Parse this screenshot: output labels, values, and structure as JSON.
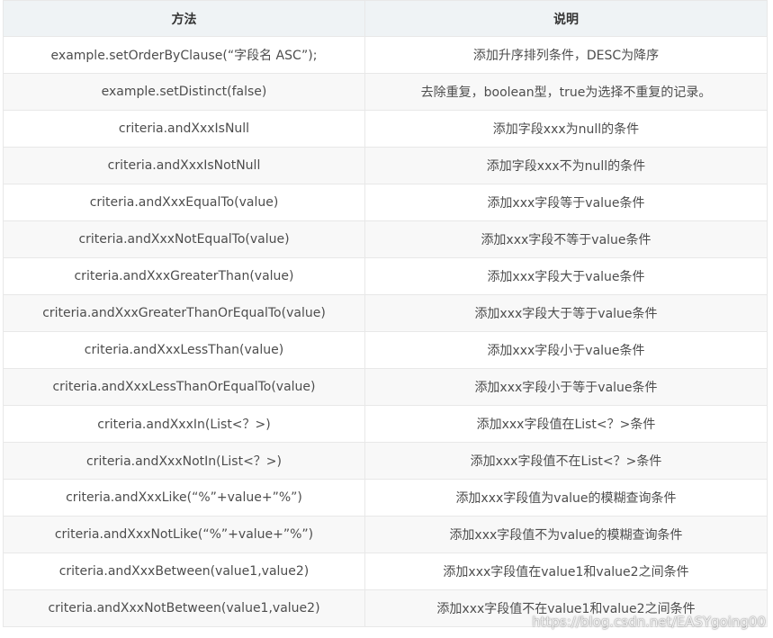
{
  "table": {
    "headers": [
      "方法",
      "说明"
    ],
    "rows": [
      [
        "example.setOrderByClause(“字段名 ASC”);",
        "添加升序排列条件，DESC为降序"
      ],
      [
        "example.setDistinct(false)",
        "去除重复，boolean型，true为选择不重复的记录。"
      ],
      [
        "criteria.andXxxIsNull",
        "添加字段xxx为null的条件"
      ],
      [
        "criteria.andXxxIsNotNull",
        "添加字段xxx不为null的条件"
      ],
      [
        "criteria.andXxxEqualTo(value)",
        "添加xxx字段等于value条件"
      ],
      [
        "criteria.andXxxNotEqualTo(value)",
        "添加xxx字段不等于value条件"
      ],
      [
        "criteria.andXxxGreaterThan(value)",
        "添加xxx字段大于value条件"
      ],
      [
        "criteria.andXxxGreaterThanOrEqualTo(value)",
        "添加xxx字段大于等于value条件"
      ],
      [
        "criteria.andXxxLessThan(value)",
        "添加xxx字段小于value条件"
      ],
      [
        "criteria.andXxxLessThanOrEqualTo(value)",
        "添加xxx字段小于等于value条件"
      ],
      [
        "criteria.andXxxIn(List<？>)",
        "添加xxx字段值在List<？>条件"
      ],
      [
        "criteria.andXxxNotIn(List<？>)",
        "添加xxx字段值不在List<？>条件"
      ],
      [
        "criteria.andXxxLike(“%”+value+”%”)",
        "添加xxx字段值为value的模糊查询条件"
      ],
      [
        "criteria.andXxxNotLike(“%”+value+”%”)",
        "添加xxx字段值不为value的模糊查询条件"
      ],
      [
        "criteria.andXxxBetween(value1,value2)",
        "添加xxx字段值在value1和value2之间条件"
      ],
      [
        "criteria.andXxxNotBetween(value1,value2)",
        "添加xxx字段值不在value1和value2之间条件"
      ]
    ]
  },
  "watermark": "https://blog.csdn.net/EASYgoing00"
}
